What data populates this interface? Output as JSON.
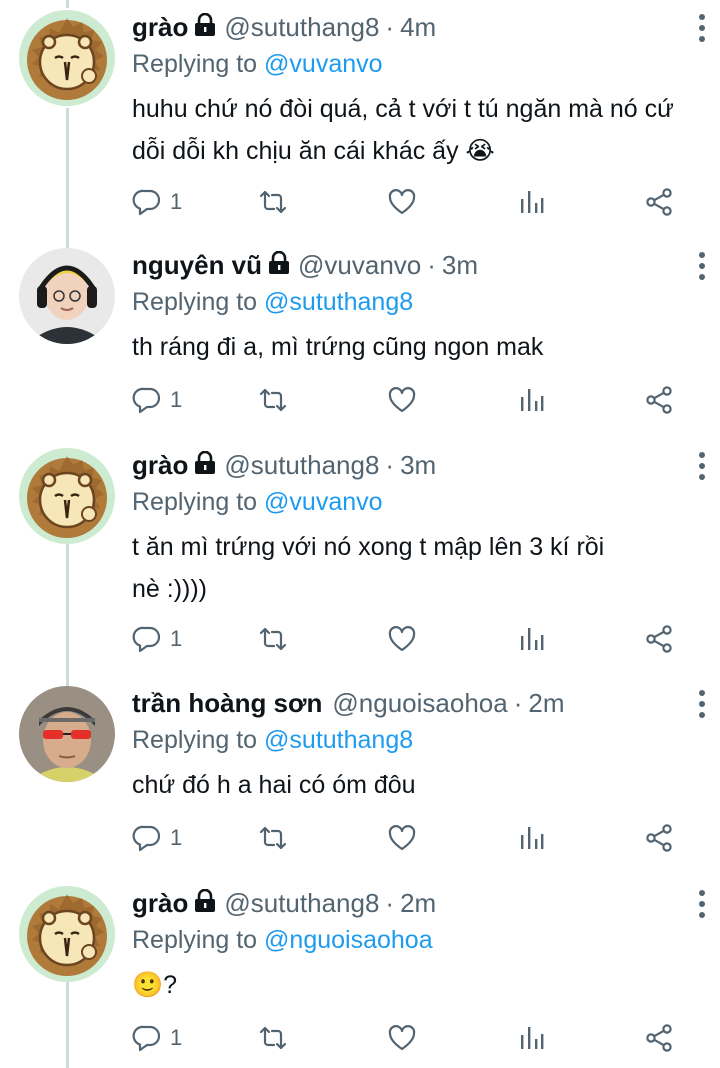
{
  "tweets": [
    {
      "name": "grào",
      "handle": "@sututhang8",
      "time": "4m",
      "replying_prefix": "Replying to",
      "replying_to": "@vuvanvo",
      "lines": [
        "huhu chứ nó đòi quá, cả t với t tú ngăn mà nó cứ",
        "dỗi dỗi kh chịu ăn cái khác ấy 😭"
      ],
      "reply_count": "1",
      "avatar": "lion-cartoon"
    },
    {
      "name": "nguyên vũ",
      "handle": "@vuvanvo",
      "time": "3m",
      "replying_prefix": "Replying to",
      "replying_to": "@sututhang8",
      "lines": [
        "th ráng đi a, mì trứng cũng ngon mak"
      ],
      "reply_count": "1",
      "avatar": "person-headphones"
    },
    {
      "name": "grào",
      "handle": "@sututhang8",
      "time": "3m",
      "replying_prefix": "Replying to",
      "replying_to": "@vuvanvo",
      "lines": [
        "t ăn mì trứng với nó xong t mập lên 3 kí rồi",
        "nè :))))"
      ],
      "reply_count": "1",
      "avatar": "lion-cartoon"
    },
    {
      "name": "trần hoàng sơn",
      "handle": "@nguoisaohoa",
      "time": "2m",
      "replying_prefix": "Replying to",
      "replying_to": "@sututhang8",
      "lines": [
        "chứ đó h a hai có óm đôu"
      ],
      "reply_count": "1",
      "avatar": "person-red-glasses"
    },
    {
      "name": "grào",
      "handle": "@sututhang8",
      "time": "2m",
      "replying_prefix": "Replying to",
      "replying_to": "@nguoisaohoa",
      "lines": [
        "🙂?"
      ],
      "reply_count": "1",
      "avatar": "lion-cartoon"
    }
  ],
  "colors": {
    "text": "#0f1419",
    "secondary": "#536471",
    "link": "#1d9bf0",
    "thread_line": "#cfd9de"
  },
  "icons": [
    "lock-icon",
    "more-icon",
    "reply-icon",
    "retweet-icon",
    "like-icon",
    "stats-icon",
    "share-icon"
  ]
}
